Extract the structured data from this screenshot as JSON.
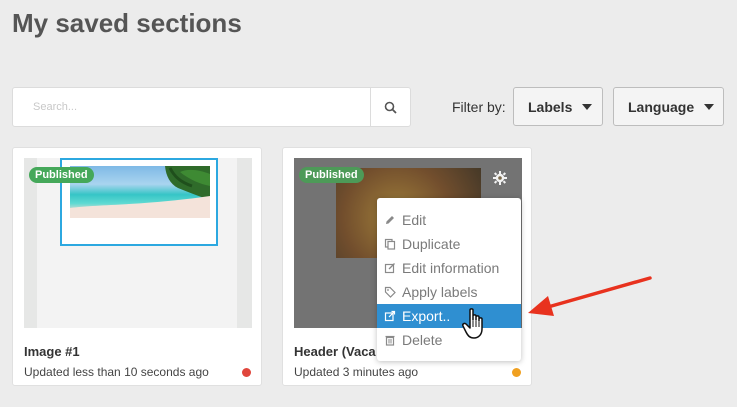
{
  "page": {
    "title": "My saved sections"
  },
  "search": {
    "placeholder": "Search...",
    "icon": "search-icon"
  },
  "filter": {
    "label": "Filter by:",
    "labels_dropdown": "Labels",
    "language_dropdown": "Language"
  },
  "cards": [
    {
      "badge": "Published",
      "title": "Image #1",
      "updated": "Updated less than 10 seconds ago",
      "status_color": "#e0463c"
    },
    {
      "badge": "Published",
      "title": "Header (Vaca",
      "updated": "Updated 3 minutes ago",
      "status_color": "#f0a020"
    }
  ],
  "context_menu": {
    "items": [
      {
        "label": "Edit",
        "icon": "pencil-icon"
      },
      {
        "label": "Duplicate",
        "icon": "copy-icon"
      },
      {
        "label": "Edit information",
        "icon": "edit-info-icon"
      },
      {
        "label": "Apply labels",
        "icon": "tag-icon"
      },
      {
        "label": "Export..",
        "icon": "export-icon",
        "highlighted": true
      },
      {
        "label": "Delete",
        "icon": "trash-icon"
      }
    ]
  },
  "colors": {
    "accent": "#2f8fd1",
    "published_badge": "#45a85a",
    "annotation_arrow": "#e8321e",
    "selection_outline": "#2ca8e0"
  }
}
